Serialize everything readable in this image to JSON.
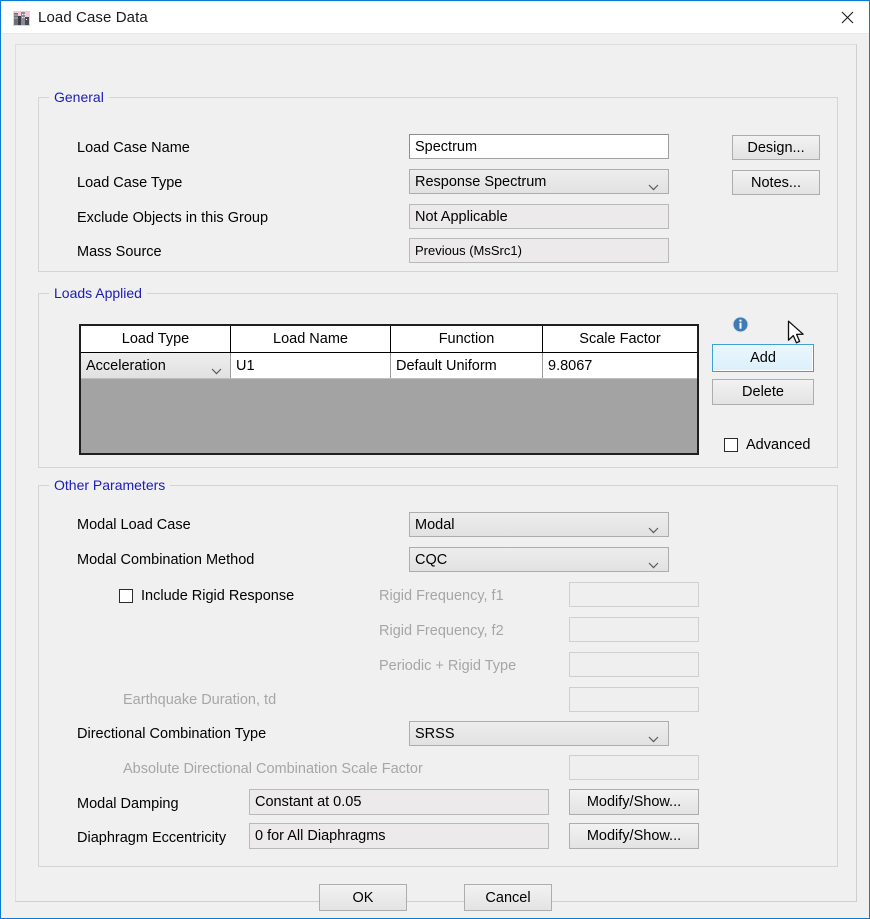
{
  "window": {
    "title": "Load Case Data",
    "icon": "app-building-icon",
    "close_label": "×",
    "border_color": "#0a7ad4",
    "background": "#f0f0f0"
  },
  "groups": {
    "general": {
      "legend": "General"
    },
    "loads_applied": {
      "legend": "Loads Applied"
    },
    "other_parameters": {
      "legend": "Other Parameters"
    }
  },
  "general": {
    "fields": [
      {
        "label": "Load Case Name",
        "value": "Spectrum"
      },
      {
        "label": "Load Case Type",
        "value": "Response Spectrum"
      },
      {
        "label": "Exclude Objects in this Group",
        "value": "Not Applicable"
      },
      {
        "label": "Mass Source",
        "value": "Previous  (MsSrc1)"
      }
    ],
    "buttons": [
      {
        "label": "Design..."
      },
      {
        "label": "Notes..."
      }
    ]
  },
  "loads_applied": {
    "columns": [
      "Load Type",
      "Load Name",
      "Function",
      "Scale Factor"
    ],
    "rows": [
      {
        "load_type": "Acceleration",
        "load_name": "U1",
        "function": "Default Uniform",
        "scale_factor": "9.8067"
      }
    ],
    "info_icon": "info-icon",
    "add_button": "Add",
    "delete_button": "Delete",
    "advanced_checkbox": {
      "label": "Advanced",
      "checked": false
    }
  },
  "other_parameters": {
    "modal_load_case": {
      "label": "Modal Load Case",
      "value": "Modal"
    },
    "modal_combination_method": {
      "label": "Modal Combination Method",
      "value": "CQC"
    },
    "include_rigid_response": {
      "label": "Include Rigid Response",
      "checked": false
    },
    "rigid_frequency_f1": {
      "label": "Rigid Frequency, f1",
      "value": ""
    },
    "rigid_frequency_f2": {
      "label": "Rigid Frequency, f2",
      "value": ""
    },
    "periodic_rigid_type": {
      "label": "Periodic + Rigid Type",
      "value": ""
    },
    "earthquake_duration": {
      "label": "Earthquake Duration, td",
      "value": ""
    },
    "directional_combination_type": {
      "label": "Directional Combination Type",
      "value": "SRSS"
    },
    "absolute_directional_scale_factor": {
      "label": "Absolute Directional Combination Scale Factor",
      "value": ""
    },
    "modal_damping": {
      "label": "Modal Damping",
      "value": "Constant at 0.05",
      "button": "Modify/Show..."
    },
    "diaphragm_eccentricity": {
      "label": "Diaphragm Eccentricity",
      "value": "0 for All Diaphragms",
      "button": "Modify/Show..."
    }
  },
  "footer": {
    "ok_label": "OK",
    "cancel_label": "Cancel"
  },
  "colors": {
    "legend_blue": "#1b1bbb",
    "accent_blue": "#0a7ad4",
    "disabled_text": "#a6a6a6",
    "table_empty_bg": "#a3a3a3"
  }
}
